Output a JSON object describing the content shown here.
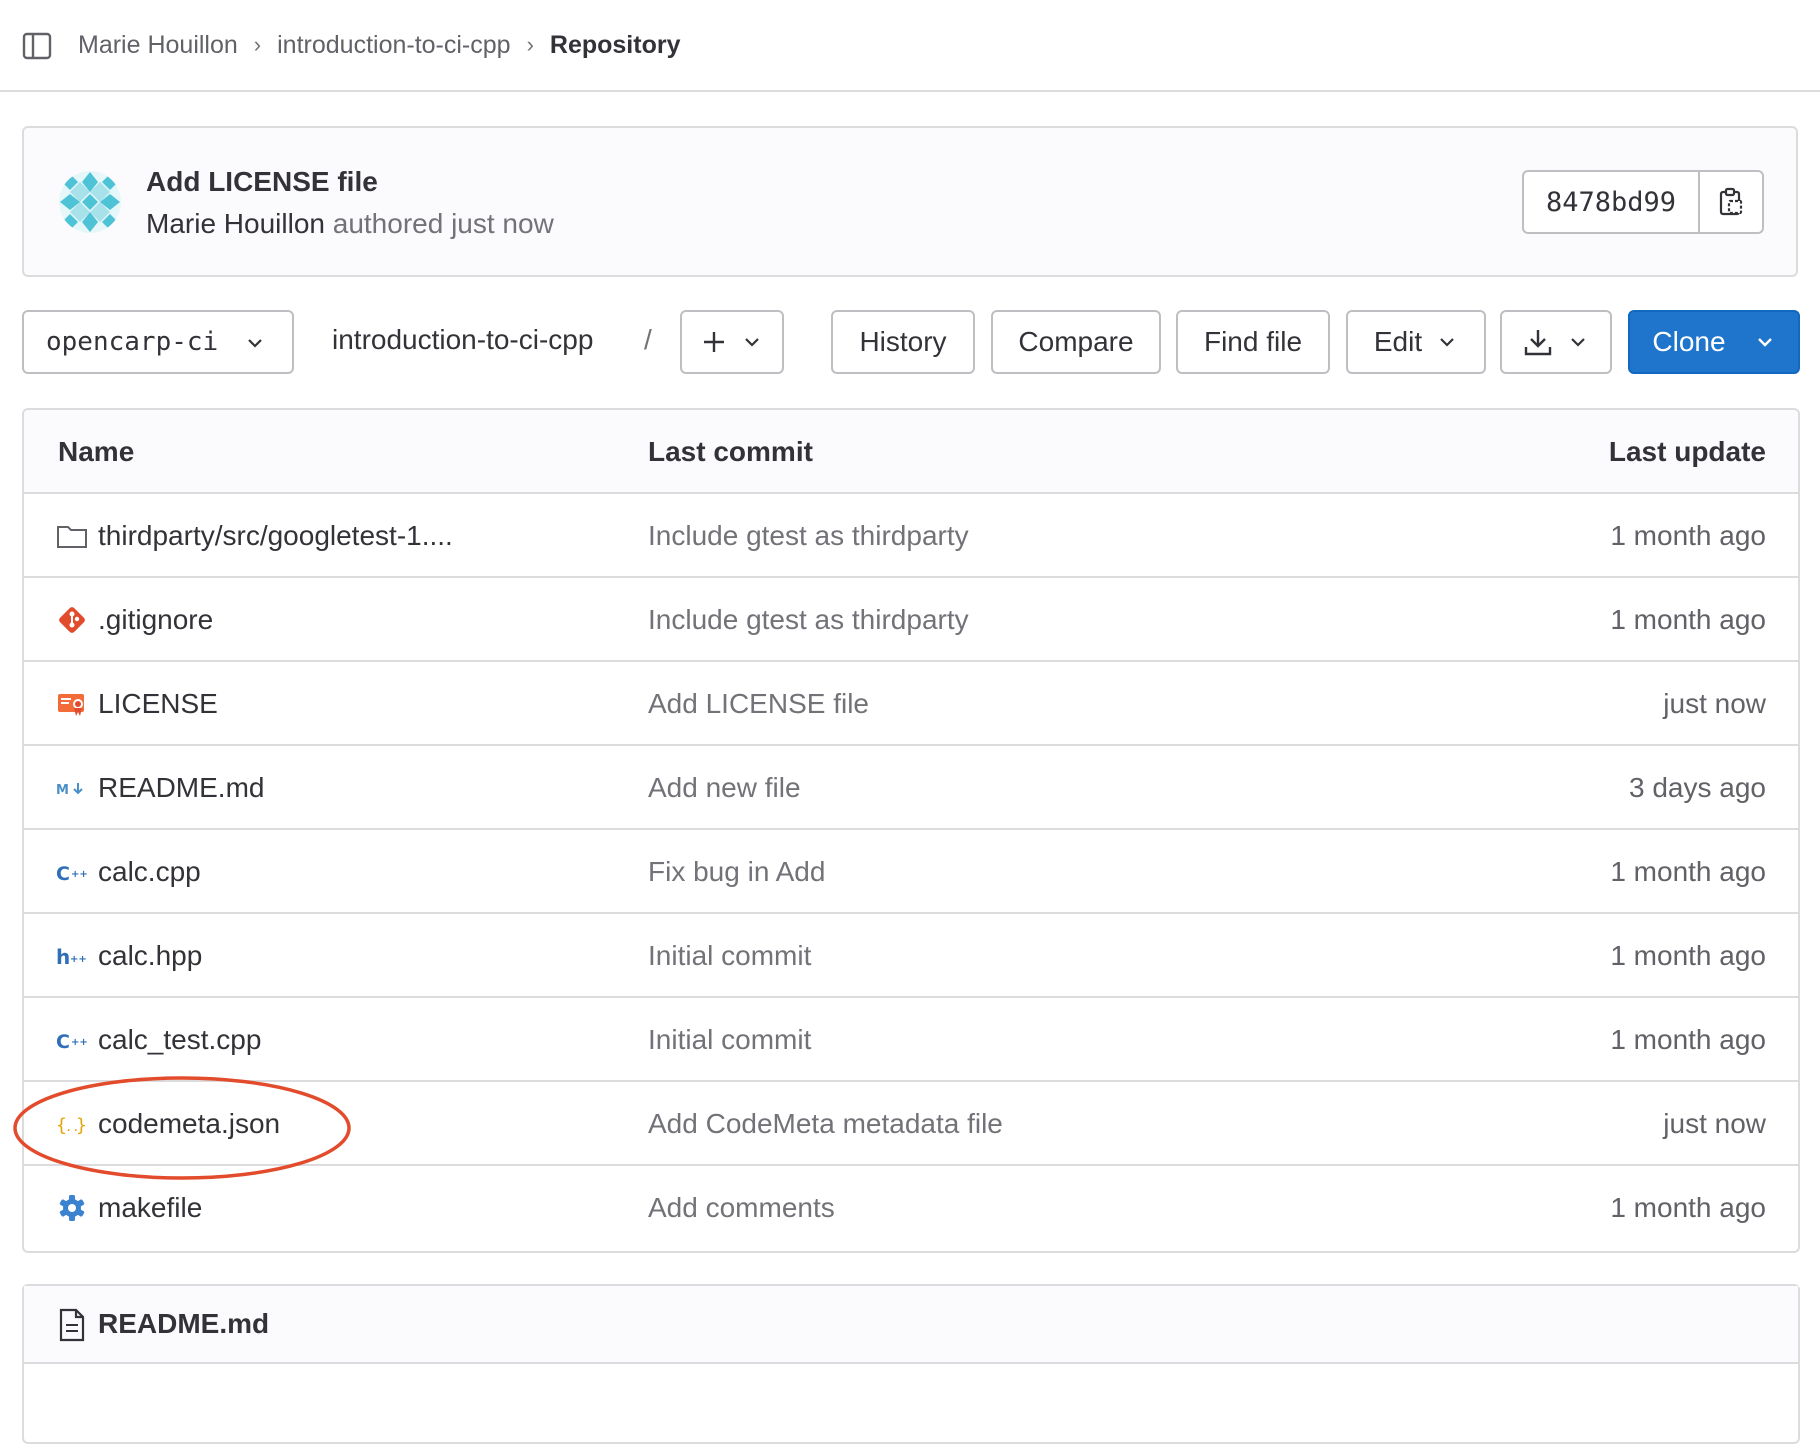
{
  "breadcrumb": {
    "items": [
      "Marie Houillon",
      "introduction-to-ci-cpp",
      "Repository"
    ],
    "separator": "›"
  },
  "last_commit": {
    "title": "Add LICENSE file",
    "author": "Marie Houillon",
    "authored_text": "authored just now",
    "sha": "8478bd99",
    "icons": {
      "avatar": "identicon-avatar",
      "copy": "clipboard-icon"
    }
  },
  "toolbar": {
    "branch": "opencarp-ci",
    "path": "introduction-to-ci-cpp",
    "path_separator": "/",
    "history_label": "History",
    "compare_label": "Compare",
    "find_file_label": "Find file",
    "edit_label": "Edit",
    "clone_label": "Clone"
  },
  "table": {
    "headers": {
      "name": "Name",
      "last_commit": "Last commit",
      "last_update": "Last update"
    },
    "rows": [
      {
        "icon": "folder-icon",
        "name": "thirdparty/src/googletest-1....",
        "commit": "Include gtest as thirdparty",
        "updated": "1 month ago"
      },
      {
        "icon": "git-icon",
        "name": ".gitignore",
        "commit": "Include gtest as thirdparty",
        "updated": "1 month ago"
      },
      {
        "icon": "license-icon",
        "name": "LICENSE",
        "commit": "Add LICENSE file",
        "updated": "just now"
      },
      {
        "icon": "markdown-icon",
        "name": "README.md",
        "commit": "Add new file",
        "updated": "3 days ago"
      },
      {
        "icon": "cpp-icon",
        "name": "calc.cpp",
        "commit": "Fix bug in Add",
        "updated": "1 month ago"
      },
      {
        "icon": "hpp-icon",
        "name": "calc.hpp",
        "commit": "Initial commit",
        "updated": "1 month ago"
      },
      {
        "icon": "cpp-icon",
        "name": "calc_test.cpp",
        "commit": "Initial commit",
        "updated": "1 month ago"
      },
      {
        "icon": "json-icon",
        "name": "codemeta.json",
        "commit": "Add CodeMeta metadata file",
        "updated": "just now"
      },
      {
        "icon": "gear-icon",
        "name": "makefile",
        "commit": "Add comments",
        "updated": "1 month ago"
      }
    ]
  },
  "readme": {
    "title": "README.md",
    "icon": "file-icon"
  },
  "annotation": {
    "highlighted_row": "codemeta.json",
    "color": "#e24b2c"
  },
  "colors": {
    "primary": "#1f75cb",
    "border": "#dcdcde",
    "muted_text": "#737278",
    "text": "#333238"
  }
}
